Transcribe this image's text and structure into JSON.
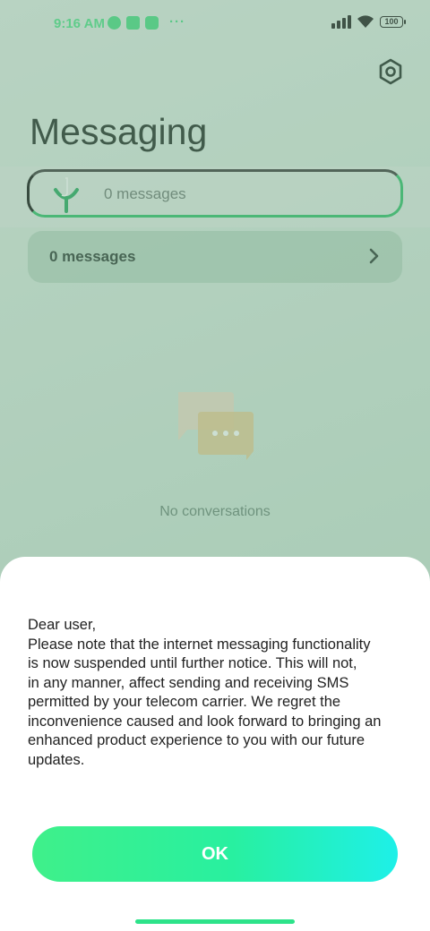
{
  "status_bar": {
    "time": "9:16 AM",
    "more": "···",
    "battery": "100",
    "accent_color": "#48dc84",
    "icons": [
      "message-notification-icon",
      "green-app-icon",
      "chat-app-icon",
      "signal-icon",
      "wifi-icon",
      "battery-icon"
    ]
  },
  "header": {
    "title": "Messaging",
    "settings_icon": "hexagon-settings-icon"
  },
  "search": {
    "text": "0 messages",
    "icon": "search-icon"
  },
  "messages_row": {
    "label": "0 messages",
    "icon": "chevron-right-icon"
  },
  "empty_state": {
    "icon": "chat-bubbles-icon",
    "text": "No conversations"
  },
  "dialog": {
    "lines": [
      "Dear user,",
      "Please note that the internet messaging functionality",
      "is now suspended until further notice. This will not,",
      "in any manner, affect sending and receiving SMS",
      "permitted by your telecom carrier. We regret the",
      "inconvenience caused and look forward to bringing an",
      "enhanced product experience to you with our future",
      "updates."
    ],
    "ok_label": "OK",
    "button_gradient": [
      "#3ff08a",
      "#1ef0e8"
    ]
  }
}
